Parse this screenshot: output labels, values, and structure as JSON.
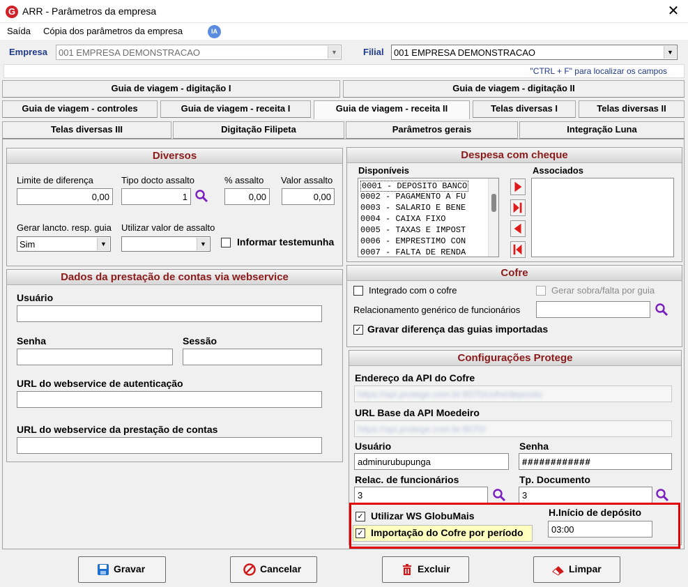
{
  "window": {
    "title": "ARR - Parâmetros da empresa",
    "close": "✕",
    "logo": "G"
  },
  "menu": {
    "items": [
      "Saída",
      "Cópia dos parâmetros da empresa"
    ],
    "ia_badge": "IA"
  },
  "empresa": {
    "label": "Empresa",
    "value": "001 EMPRESA DEMONSTRACAO"
  },
  "filial": {
    "label": "Filial",
    "value": "001 EMPRESA DEMONSTRACAO"
  },
  "hint": "\"CTRL + F\" para localizar os campos",
  "tabs": {
    "row1": [
      "Guia de viagem - digitação I",
      "Guia de viagem - digitação II"
    ],
    "row2": [
      "Guia de viagem - controles",
      "Guia de viagem - receita I",
      "Guia de viagem - receita II",
      "Telas diversas I",
      "Telas diversas II"
    ],
    "row3": [
      "Telas diversas III",
      "Digitação Filipeta",
      "Parâmetros gerais",
      "Integração Luna"
    ]
  },
  "diversos": {
    "title": "Diversos",
    "limite_label": "Limite de diferença",
    "limite_value": "0,00",
    "tipo_label": "Tipo docto assalto",
    "tipo_value": "1",
    "pct_label": "% assalto",
    "pct_value": "0,00",
    "valor_label": "Valor assalto",
    "valor_value": "0,00",
    "gerar_label": "Gerar lancto. resp. guia",
    "gerar_value": "Sim",
    "utilizar_label": "Utilizar valor de assalto",
    "utilizar_value": "",
    "informar_label": "Informar testemunha"
  },
  "webservice": {
    "title": "Dados da prestação de contas via webservice",
    "usuario_label": "Usuário",
    "senha_label": "Senha",
    "sessao_label": "Sessão",
    "url_auth_label": "URL do webservice de autenticação",
    "url_prest_label": "URL do webservice da prestação de contas"
  },
  "despesa": {
    "title": "Despesa com cheque",
    "disponiveis_label": "Disponíveis",
    "associados_label": "Associados",
    "items": [
      "0001 - DEPOSITO BANCO",
      "0002 - PAGAMENTO A FU",
      "0003 - SALARIO E BENE",
      "0004 - CAIXA FIXO",
      "0005 - TAXAS E IMPOST",
      "0006 - EMPRESTIMO CON",
      "0007 - FALTA DE RENDA"
    ]
  },
  "cofre": {
    "title": "Cofre",
    "integrado_label": "Integrado com o cofre",
    "gerar_label": "Gerar sobra/falta por guia",
    "relac_label": "Relacionamento genérico de funcionários",
    "gravar_label": "Gravar diferença das guias importadas"
  },
  "protege": {
    "title": "Configurações Protege",
    "endereco_label": "Endereço da API do Cofre",
    "endereco_value": "https://api.protege.com.br:8070/cofre/deposito",
    "url_moedeiro_label": "URL Base da API Moedeiro",
    "url_moedeiro_value": "https://api.protege.com.br:8070/",
    "usuario_label": "Usuário",
    "usuario_value": "adminurubupunga",
    "senha_label": "Senha",
    "senha_value": "############",
    "relac_label": "Relac. de funcionários",
    "relac_value": "3",
    "tp_label": "Tp. Documento",
    "tp_value": "3",
    "ws_label": "Utilizar WS GlobuMais",
    "importacao_label": "Importação do Cofre por período",
    "hinicio_label": "H.Início de depósito",
    "hinicio_value": "03:00"
  },
  "buttons": {
    "gravar": "Gravar",
    "cancelar": "Cancelar",
    "excluir": "Excluir",
    "limpar": "Limpar"
  },
  "colors": {
    "accent_red": "#8b1a1a",
    "label_blue": "#1f3a8a",
    "highlight_box": "#e00000",
    "highlight_yellow": "#ffffc0"
  }
}
